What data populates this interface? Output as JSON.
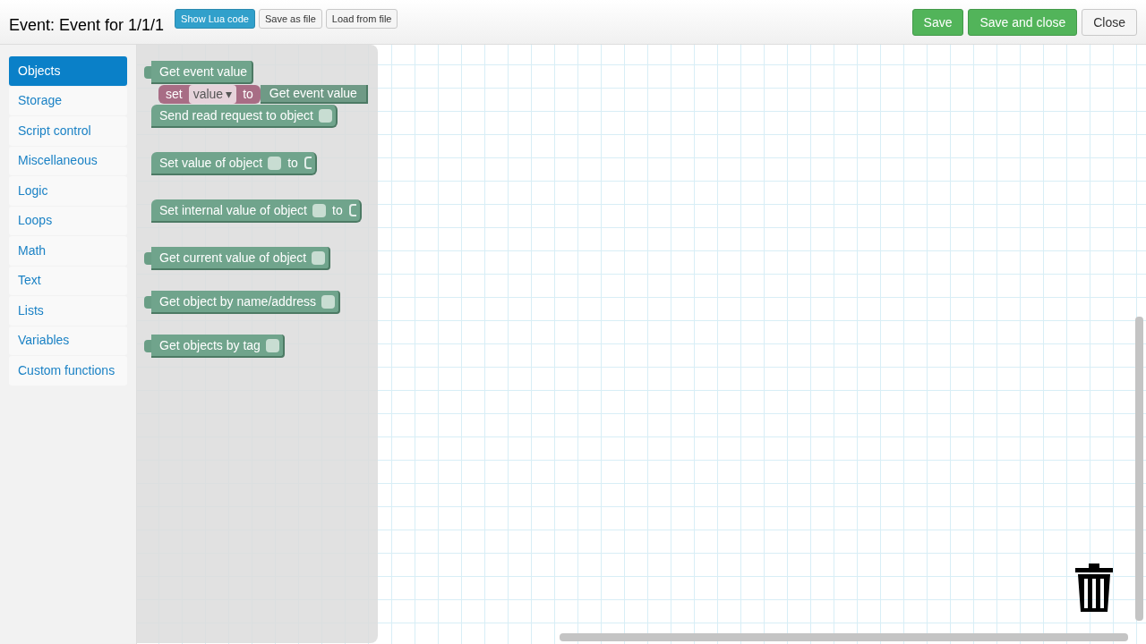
{
  "header": {
    "title": "Event: Event for 1/1/1",
    "tool_buttons": [
      {
        "label": "Show Lua code",
        "kind": "primary"
      },
      {
        "label": "Save as file",
        "kind": "default"
      },
      {
        "label": "Load from file",
        "kind": "default"
      }
    ],
    "actions": [
      {
        "label": "Save",
        "kind": "success"
      },
      {
        "label": "Save and close",
        "kind": "success"
      },
      {
        "label": "Close",
        "kind": "default"
      }
    ]
  },
  "categories": [
    {
      "label": "Objects",
      "selected": true
    },
    {
      "label": "Storage",
      "selected": false
    },
    {
      "label": "Script control",
      "selected": false
    },
    {
      "label": "Miscellaneous",
      "selected": false
    },
    {
      "label": "Logic",
      "selected": false
    },
    {
      "label": "Loops",
      "selected": false
    },
    {
      "label": "Math",
      "selected": false
    },
    {
      "label": "Text",
      "selected": false
    },
    {
      "label": "Lists",
      "selected": false
    },
    {
      "label": "Variables",
      "selected": false
    },
    {
      "label": "Custom functions",
      "selected": false
    }
  ],
  "blocks": [
    {
      "kind": "output",
      "label": "Get event value",
      "slot": false
    },
    {
      "kind": "statement",
      "label": "Send read request to object",
      "slot": true
    },
    {
      "kind": "statement",
      "label": "Set value of object",
      "slot": true,
      "suffix": "to"
    },
    {
      "kind": "statement",
      "label": "Set internal value of object",
      "slot": true,
      "suffix": "to"
    },
    {
      "kind": "output",
      "label": "Get current value of object",
      "slot": true
    },
    {
      "kind": "output",
      "label": "Get object by name/address",
      "slot": true
    },
    {
      "kind": "output",
      "label": "Get objects by tag",
      "slot": true
    }
  ],
  "dragged_block": {
    "keyword": "set",
    "variable": "value",
    "dropdown_arrow": "▾",
    "connector": "to",
    "value": "Get event value"
  }
}
